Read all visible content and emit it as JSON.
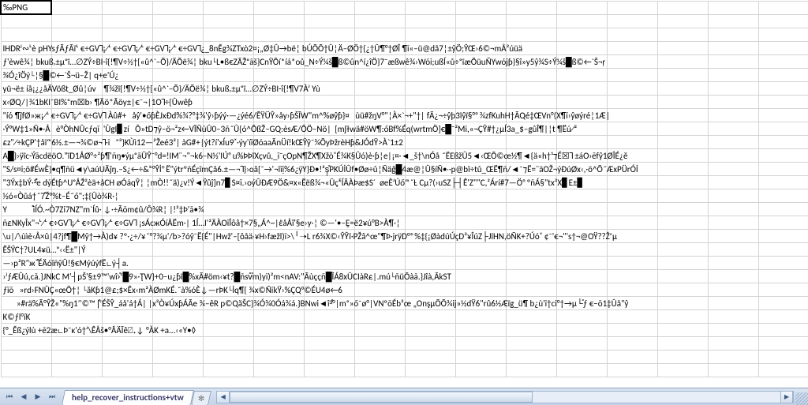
{
  "sheet": {
    "rows": [
      "‰PNG",
      "\u001a",
      "",
      "IHDRʲ∾ᴸè pHYsƒÃƒÃïᴸ €÷GV˥¡∕ᴸ €÷GV˥¡∕ᴸ €÷GV˥¡∕ᴸ €÷GV˥¿_8nĚg¾ZTxò2¤¡„Ø‡Û→bë¦ bÚÕÕ†Û¦Ä–ØÖ†{¿†Û¶°†ØÎ ¶ĩ«–ü@då7¦±ŷÖ;ŶŒ›6©¬mÅ²úüä",
      "ƒ'èwê¾¦ bkuß͵±µᵒï…∅ZÝ÷BI-î{!¶V÷½†[«û^`–Õ}/ÄÕë¾¦ bku└L•ß€ZÃŽᵒãš}CnŸÕí*íá*oů_N÷Ý¼š█ß©ûn^í¿îÖ}7¯æßwê¾›Wói;ußÍ«ů÷ᵒïæÕüuŇYwójƥ}§î»y5ŷ¾S÷Ý¼š█ß©←`Š¬ŗ",
      "¾Ó¿îÖý└¦§█©←`Š¬ü–Ž| q+e'Ú¿",
      "yü¬ë± íå¡¿¿åÄVößt_Øû¦úv    ¶¾žï{!¶V÷½†[«û^`–Õ}/ÄÕë¾¦ bkuß͵±µᵒï…∅ZÝ÷BI-î{!¶V7Àᴶ Yù",
      "x‹ØQ/|¾1bKI¯BI%ᵒm☒b› ¶Äö*Ãöy±|€¯¬|1O˥÷{Ûwêƥ",
      "\"íó ¶ĵfØ»ж¡∕ᴸ €÷GV˥¡∕ᴸ €÷GV˥ Àû#+   åŷ'•őƥÈJxĐd%¾?°‡¾'ŷ›ƥýý·—¿ýé6/ĔŸÜŶ»åy›ƥŠĨW\"m^%øŷƥ}¤   ùü#žŋV°\"¦À×`¬+\"†| fÃ¿¬÷ŷþ3ïŷï§°®¾zfKuhH†ÃQé‡ŒVn°(X¶ĩ›ŷøýré¦1Æ|",
      "·Ý°W‡1»Ñ•·Å   è°ÒhNÛcƒqĩ  'ÙgI▊zí   Ô»tD⁊ŷ–ö¬²z←VĨÑũÛ0–3ñ˝Û{ó^ÕßŽ–GQ:èsÆ/ÕÖ–Nö|  [mʃɫwä#öW¶:őBf%Éq(wrtmÖ]€█¯²Mi,«¬ÇŶ#†¿µÍ3a_$–gûÎ¶|¦t ¶Ëú∕²",
      "£z\"∕÷kÇP'†åïᵐ6½.±—¬¾©ø¬˥·ĩ   ⁿ³}KÙì12—²Žeé3²| àG#+|ýt?í'xÍu9˟·ýy'íīØóaaÃnÜí!kŒŶŷ¯¾ÕyÞžrèHƥ&JÓdŸ>À`1±2",
      "A█}›ÿïc-ÝãcdëöO.\"ïD1ÅØ°÷²ƥ¶'ñŋ•ýµᵒãÜŶ¯°d=!IM¨¬\"¬k6–N½'IÚ®u%ÞÞïXçvů,_ĩ¯çOpN¶ŽX¶Xžò˟É¾K§Ûó)è·ƥ¦e|¡¤·◄_š†\\nÓå ˝ËEßžÛ5◄‹ŒÕ©œ½¶◄{ä«h†¹⁊É☒˥ ±áO›ēfŷ1ØÎÉ¿ĕ",
      "\"S/s¤i;ö#ÉwÈ}•q¶ñü◄y\\aúUÄĵŋ.–S¿←÷&ᵇ°Ŷİ®Ë\"ýtrºñÉçïmÇå6.±—¬˥}›oâ[¯→'¬ïĩị%6¿ÿY}Ð•!³ş̩̊PKÚİÛf•Øø÷ů¦Ñäĝ█4æ@¦Û§íÑ•˒·p@bï÷tů_ŒË¶ñ/◄¯⁊Ë=¨äOŽ¬ýÐúØx‹,·ö^Õ˝ÆxPÜrÓİ",
      "\"3Ýx‡bÝ·³̊̊e dýÉtƥ^UᵒÅŽ²èä+åCH øÓáqŶ¦ ¦mÒ!!˝ä)¿v!Ý◄Ŷûĵ]n7▊S¤ī.›oýÛÐÆ9Ö&¤x«Ëëß¾᷉¬«ÛçᴱÍÄÀÞæ$S´  øeÈᴶÚőᵐ˝Ƚ Cµ?(›uSZ├┤Ê'Z\"\"C,²Árí#7—Ö®ºñÁ§\"tx²X▊E±▊",
      "½ó«Òůá†˝7̊Ž°%t–É˝ő\";‡{Ûò¾R·¦",
      "Y             ̊̊iÍÓ.~Ò7Zi7NZ\"m`Íû· ↓·÷Ãõm¢û/Ô¾R¦ |!²‡Þ'᷉ã•¾",
      "ñ£NKyÎx\"¬ᴸ∕ᴸ €÷GV˥¡∕ᴸ €÷GV˥¡∕ᴸ €÷GV˥ ¡sÁcжÓíÅËm·| 1Í…I'³ÄÀOĩÎôâ†×7§„Á^~|ἒåÅĭ'§e›y·¦ ©—'•–Ḙ=ë2¥ú°B>À¶·¦",
      "\\u|/\\ùìè‹Å×û|4?jf¶█Mŷ†→À)d¥ ?º·¿÷/¥˝°?¾µ'/b>?óŷ¯Ë{É\"|Hwž'–[ôåä˒¥H›fæžl)ĩ>\\╵➝L r6¾X©‹ŶŶï·PŽâ^œ\"¶Þ·jrÿD°®%‡{¡ØàdúÚçD³¥ÎúZ├JïHN,öÑK+?Úó˟ ¢¯'€¬\"'s†¬@OŸ??Žᶜμ",
      "ĔŠÝC†?UL4¥ü…ᵒ‹‹Ë±\"|Ý",
      "—›p²R\"ж`̊̊ÉÄóĭñŷÛ!§€MýúýfË∟ý┤a.",
      "›ʲƒÆÛú,cã.}JNkC M'┤pŠ'§±9™'wî›̊ᶜ█9»·ŢW}+0−u¿ƥï█%xÃ#öm‹¥t?█ñsv̊̊m)yi)²m<nAV:\"Ãùççñ█ÎÁ8xÛCIàR£|.mú└ñüÕàã.}Jîà,ÃkST",
      "ƒīō   »rd›FNÛÇ«œÖ†¦ └ăKƥ1@£;$×Êx‹m³ÀØmKÉ.˝à%óÈ↓—rÞK└İq¶{ ¾x©ÑĩkŸ›%ÇQ°©ÉU4ø←6",
      "       »#rä%Ã°ŶŽ«\"%ŋ1’'©™ |̊ᶜÉŠŶ_áå'á†Á| |x²Ò¥ÚxƥÁÃe ¾–êR p©QăŠC}¾Ó¾0Óá¾á.}BNwi◄î³̊°|mᵒ»ő¯ø°|VNºōÉb²œ „OnşμÕÕ¾ĳ»½dŸ6\"rû6½Æïg_ü¶ b¿ù'ĩ†ci°†→μ└̊ƒ €−ō1‡Ûå\"ŷ",
      "K©ƒl°íK",
      "{°_Ěß¿ýlù +ē2æ∟Þ¯ĸ'ó†ᴶ\\ÊÅš•°ÂÄĨê⍁₊↓ °ÀK +a...‹«Y•◊"
    ]
  },
  "tab": {
    "active": "help_recover_instructions+vtw",
    "add_tooltip": "Insert Worksheet"
  },
  "nav": {
    "first": "⏮",
    "prev": "◀",
    "next": "▶",
    "last": "⏭"
  },
  "scroll": {
    "left": "◀",
    "right": "▶"
  }
}
